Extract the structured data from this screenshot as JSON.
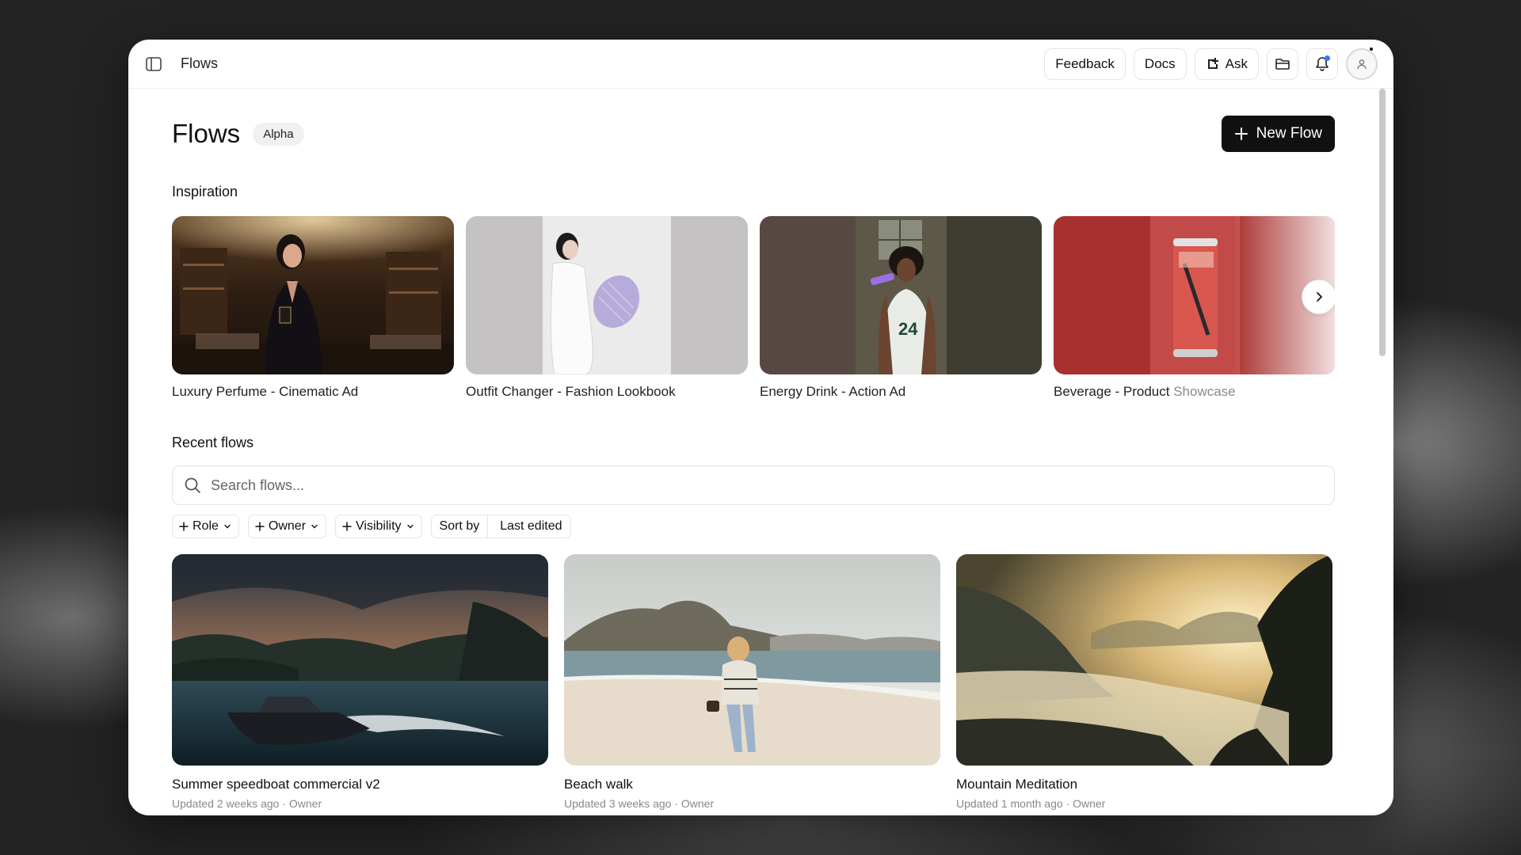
{
  "app": {
    "topbar_title": "Flows",
    "buttons": {
      "feedback": "Feedback",
      "docs": "Docs",
      "ask": "Ask"
    }
  },
  "page": {
    "title": "Flows",
    "badge": "Alpha",
    "new_flow_label": "New Flow"
  },
  "inspiration": {
    "title": "Inspiration",
    "items": [
      {
        "title": "Luxury Perfume - Cinematic Ad"
      },
      {
        "title": "Outfit Changer - Fashion Lookbook"
      },
      {
        "title": "Energy Drink - Action Ad"
      },
      {
        "title": "Beverage - Product Showcase"
      }
    ]
  },
  "recent": {
    "title": "Recent flows",
    "search_placeholder": "Search flows...",
    "filters": {
      "role": "Role",
      "owner": "Owner",
      "visibility": "Visibility"
    },
    "sort": {
      "label": "Sort by",
      "value": "Last edited"
    },
    "items": [
      {
        "title": "Summer speedboat commercial v2",
        "meta": "Updated 2 weeks ago · Owner"
      },
      {
        "title": "Beach walk",
        "meta": "Updated 3 weeks ago · Owner"
      },
      {
        "title": "Mountain Meditation",
        "meta": "Updated 1 month ago · Owner"
      }
    ]
  },
  "colors": {
    "accent": "#111111",
    "notification": "#2f7cf6"
  },
  "icons": [
    "sidebar-toggle-icon",
    "ask-icon",
    "folder-icon",
    "bell-icon",
    "user-icon",
    "plus-icon",
    "chevron-right-icon",
    "search-icon",
    "chevron-down-icon"
  ]
}
